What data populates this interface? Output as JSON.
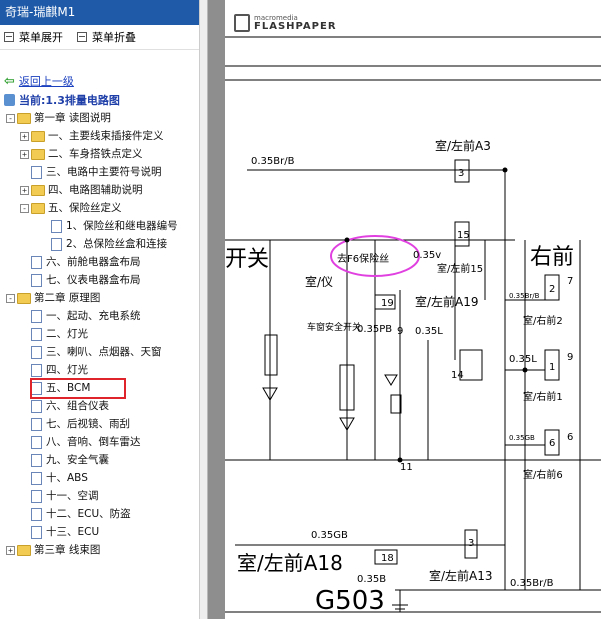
{
  "window": {
    "title": "奇瑞-瑞麒M1"
  },
  "toolbar": {
    "expand_label": "菜单展开",
    "collapse_label": "菜单折叠"
  },
  "nav": {
    "back_label": "返回上一级",
    "current_label": "当前:1.3排量电路图"
  },
  "tree": {
    "items": [
      {
        "label": "第一章 读图说明",
        "indent": 0,
        "expander": "-",
        "kind": "folder"
      },
      {
        "label": "一、主要线束插接件定义",
        "indent": 1,
        "expander": "+",
        "kind": "folder"
      },
      {
        "label": "二、车身搭铁点定义",
        "indent": 1,
        "expander": "+",
        "kind": "folder"
      },
      {
        "label": "三、电路中主要符号说明",
        "indent": 1,
        "expander": "",
        "kind": "doc"
      },
      {
        "label": "四、电路图辅助说明",
        "indent": 1,
        "expander": "+",
        "kind": "folder"
      },
      {
        "label": "五、保险丝定义",
        "indent": 1,
        "expander": "-",
        "kind": "folder"
      },
      {
        "label": "1、保险丝和继电器编号",
        "indent": 2,
        "expander": "",
        "kind": "doc"
      },
      {
        "label": "2、总保险丝盒和连接",
        "indent": 2,
        "expander": "",
        "kind": "doc"
      },
      {
        "label": "六、前舱电器盒布局",
        "indent": 1,
        "expander": "",
        "kind": "doc"
      },
      {
        "label": "七、仪表电器盒布局",
        "indent": 1,
        "expander": "",
        "kind": "doc"
      },
      {
        "label": "第二章 原理图",
        "indent": 0,
        "expander": "-",
        "kind": "folder"
      },
      {
        "label": "一、起动、充电系统",
        "indent": 1,
        "expander": "",
        "kind": "doc"
      },
      {
        "label": "二、灯光",
        "indent": 1,
        "expander": "",
        "kind": "doc"
      },
      {
        "label": "三、喇叭、点烟器、天窗",
        "indent": 1,
        "expander": "",
        "kind": "doc"
      },
      {
        "label": "四、灯光",
        "indent": 1,
        "expander": "",
        "kind": "doc"
      },
      {
        "label": "五、BCM",
        "indent": 1,
        "expander": "",
        "kind": "doc",
        "selected": true
      },
      {
        "label": "六、组合仪表",
        "indent": 1,
        "expander": "",
        "kind": "doc"
      },
      {
        "label": "七、后视镜、雨刮",
        "indent": 1,
        "expander": "",
        "kind": "doc"
      },
      {
        "label": "八、音响、倒车雷达",
        "indent": 1,
        "expander": "",
        "kind": "doc"
      },
      {
        "label": "九、安全气囊",
        "indent": 1,
        "expander": "",
        "kind": "doc"
      },
      {
        "label": "十、ABS",
        "indent": 1,
        "expander": "",
        "kind": "doc"
      },
      {
        "label": "十一、空调",
        "indent": 1,
        "expander": "",
        "kind": "doc"
      },
      {
        "label": "十二、ECU、防盗",
        "indent": 1,
        "expander": "",
        "kind": "doc"
      },
      {
        "label": "十三、ECU",
        "indent": 1,
        "expander": "",
        "kind": "doc"
      },
      {
        "label": "第三章 线束图",
        "indent": 0,
        "expander": "+",
        "kind": "folder"
      }
    ]
  },
  "viewer": {
    "brand_top": "macromedia",
    "brand_bottom": "FLASHPAPER",
    "labels": {
      "wire_brb_top": "0.35Br/B",
      "conn_a3": "室/左前A3",
      "pin_3": "3",
      "switch_text": "开关",
      "pin_15": "15",
      "fuse_note": "去F6保险丝",
      "wire_035v": "0.35v",
      "conn_a15": "室/左前15",
      "right_header": "右前",
      "pin_2": "2",
      "pin_7": "7",
      "wire_035brb_small": "0.35Br/B",
      "conn_a2": "室/右前2",
      "conn_interior": "室/仪",
      "pin_19": "19",
      "conn_a19": "室/左前A19",
      "door_switch_text": "车窗安全开关",
      "wire_035pb": "0.35PB",
      "pin_9": "9",
      "wire_035l": "0.35L",
      "pin_14": "14",
      "wire_035l_2": "0.35L",
      "pin_1": "1",
      "pin_9b": "9",
      "conn_a1": "室/右前1",
      "wire_035gb_small": "0.35GB",
      "pin_6": "6",
      "pin_6b": "6",
      "conn_a6": "室/右前6",
      "pin_11": "11",
      "wire_035gb": "0.35GB",
      "conn_a18": "室/左前A18",
      "pin_18": "18",
      "pin_3b": "3",
      "conn_a13": "室/左前A13",
      "wire_035b": "0.35B",
      "ground": "G503",
      "wire_035brb_bottom": "0.35Br/B"
    }
  },
  "colors": {
    "titlebar": "#1e5aa8",
    "highlight_box": "#e0242c",
    "annotation_ellipse": "#e040e0",
    "viewer_bg": "#8e8e8e"
  }
}
